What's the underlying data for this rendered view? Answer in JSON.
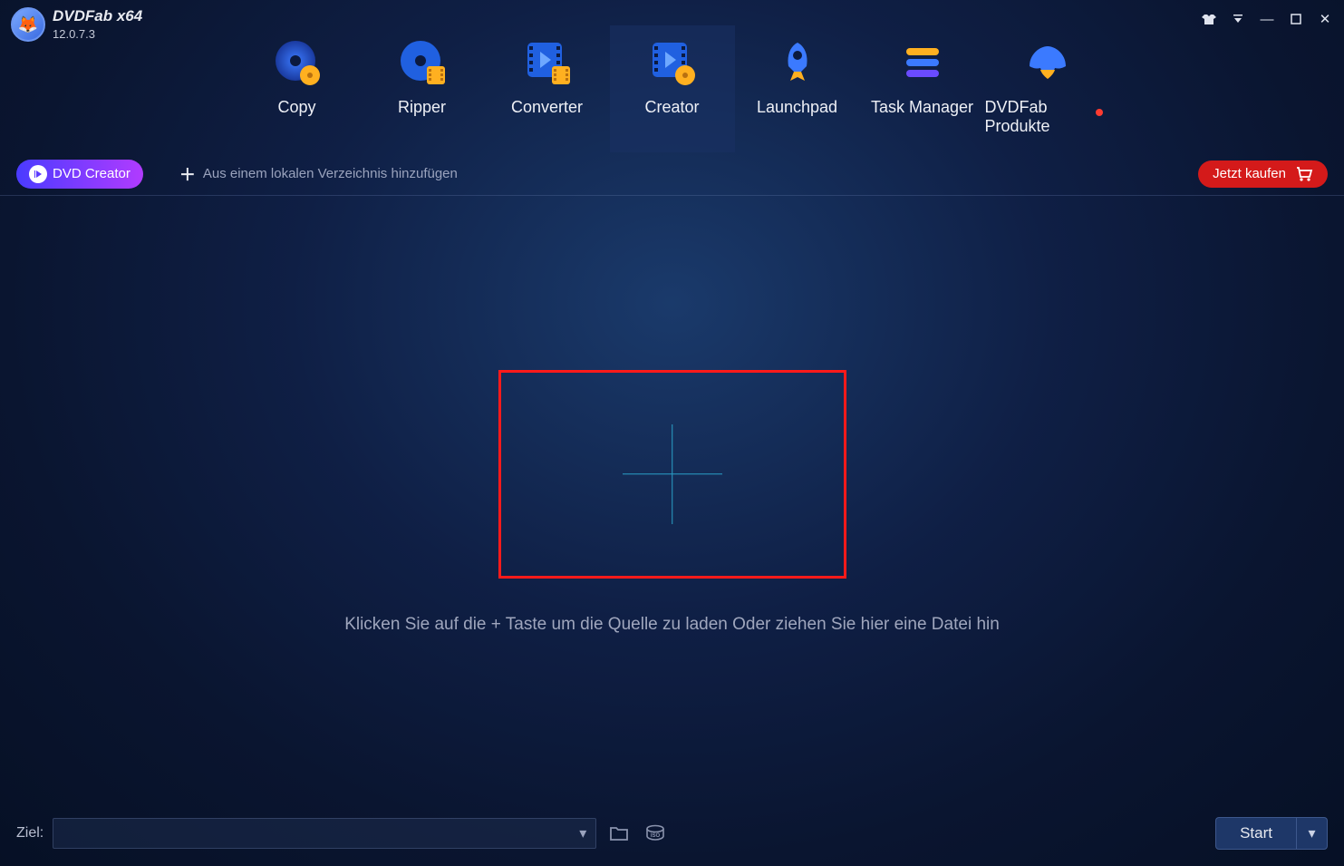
{
  "app": {
    "name": "DVDFab x64",
    "version": "12.0.7.3"
  },
  "window_controls": {
    "skin": "👕",
    "dropdown": "▾",
    "minimize": "—",
    "maximize": "▢",
    "close": "✕"
  },
  "nav": [
    {
      "id": "copy",
      "label": "Copy"
    },
    {
      "id": "ripper",
      "label": "Ripper"
    },
    {
      "id": "converter",
      "label": "Converter"
    },
    {
      "id": "creator",
      "label": "Creator",
      "active": true
    },
    {
      "id": "launchpad",
      "label": "Launchpad"
    },
    {
      "id": "task-manager",
      "label": "Task Manager"
    },
    {
      "id": "products",
      "label": "DVDFab Produkte",
      "notification": true
    }
  ],
  "action_bar": {
    "mode_label": "DVD Creator",
    "add_local_label": "Aus einem lokalen Verzeichnis hinzufügen",
    "buy_label": "Jetzt kaufen"
  },
  "main": {
    "hint": "Klicken Sie auf die + Taste um die Quelle zu laden Oder ziehen Sie hier eine Datei hin"
  },
  "bottom": {
    "ziel_label": "Ziel:",
    "ziel_value": "",
    "start_label": "Start"
  }
}
